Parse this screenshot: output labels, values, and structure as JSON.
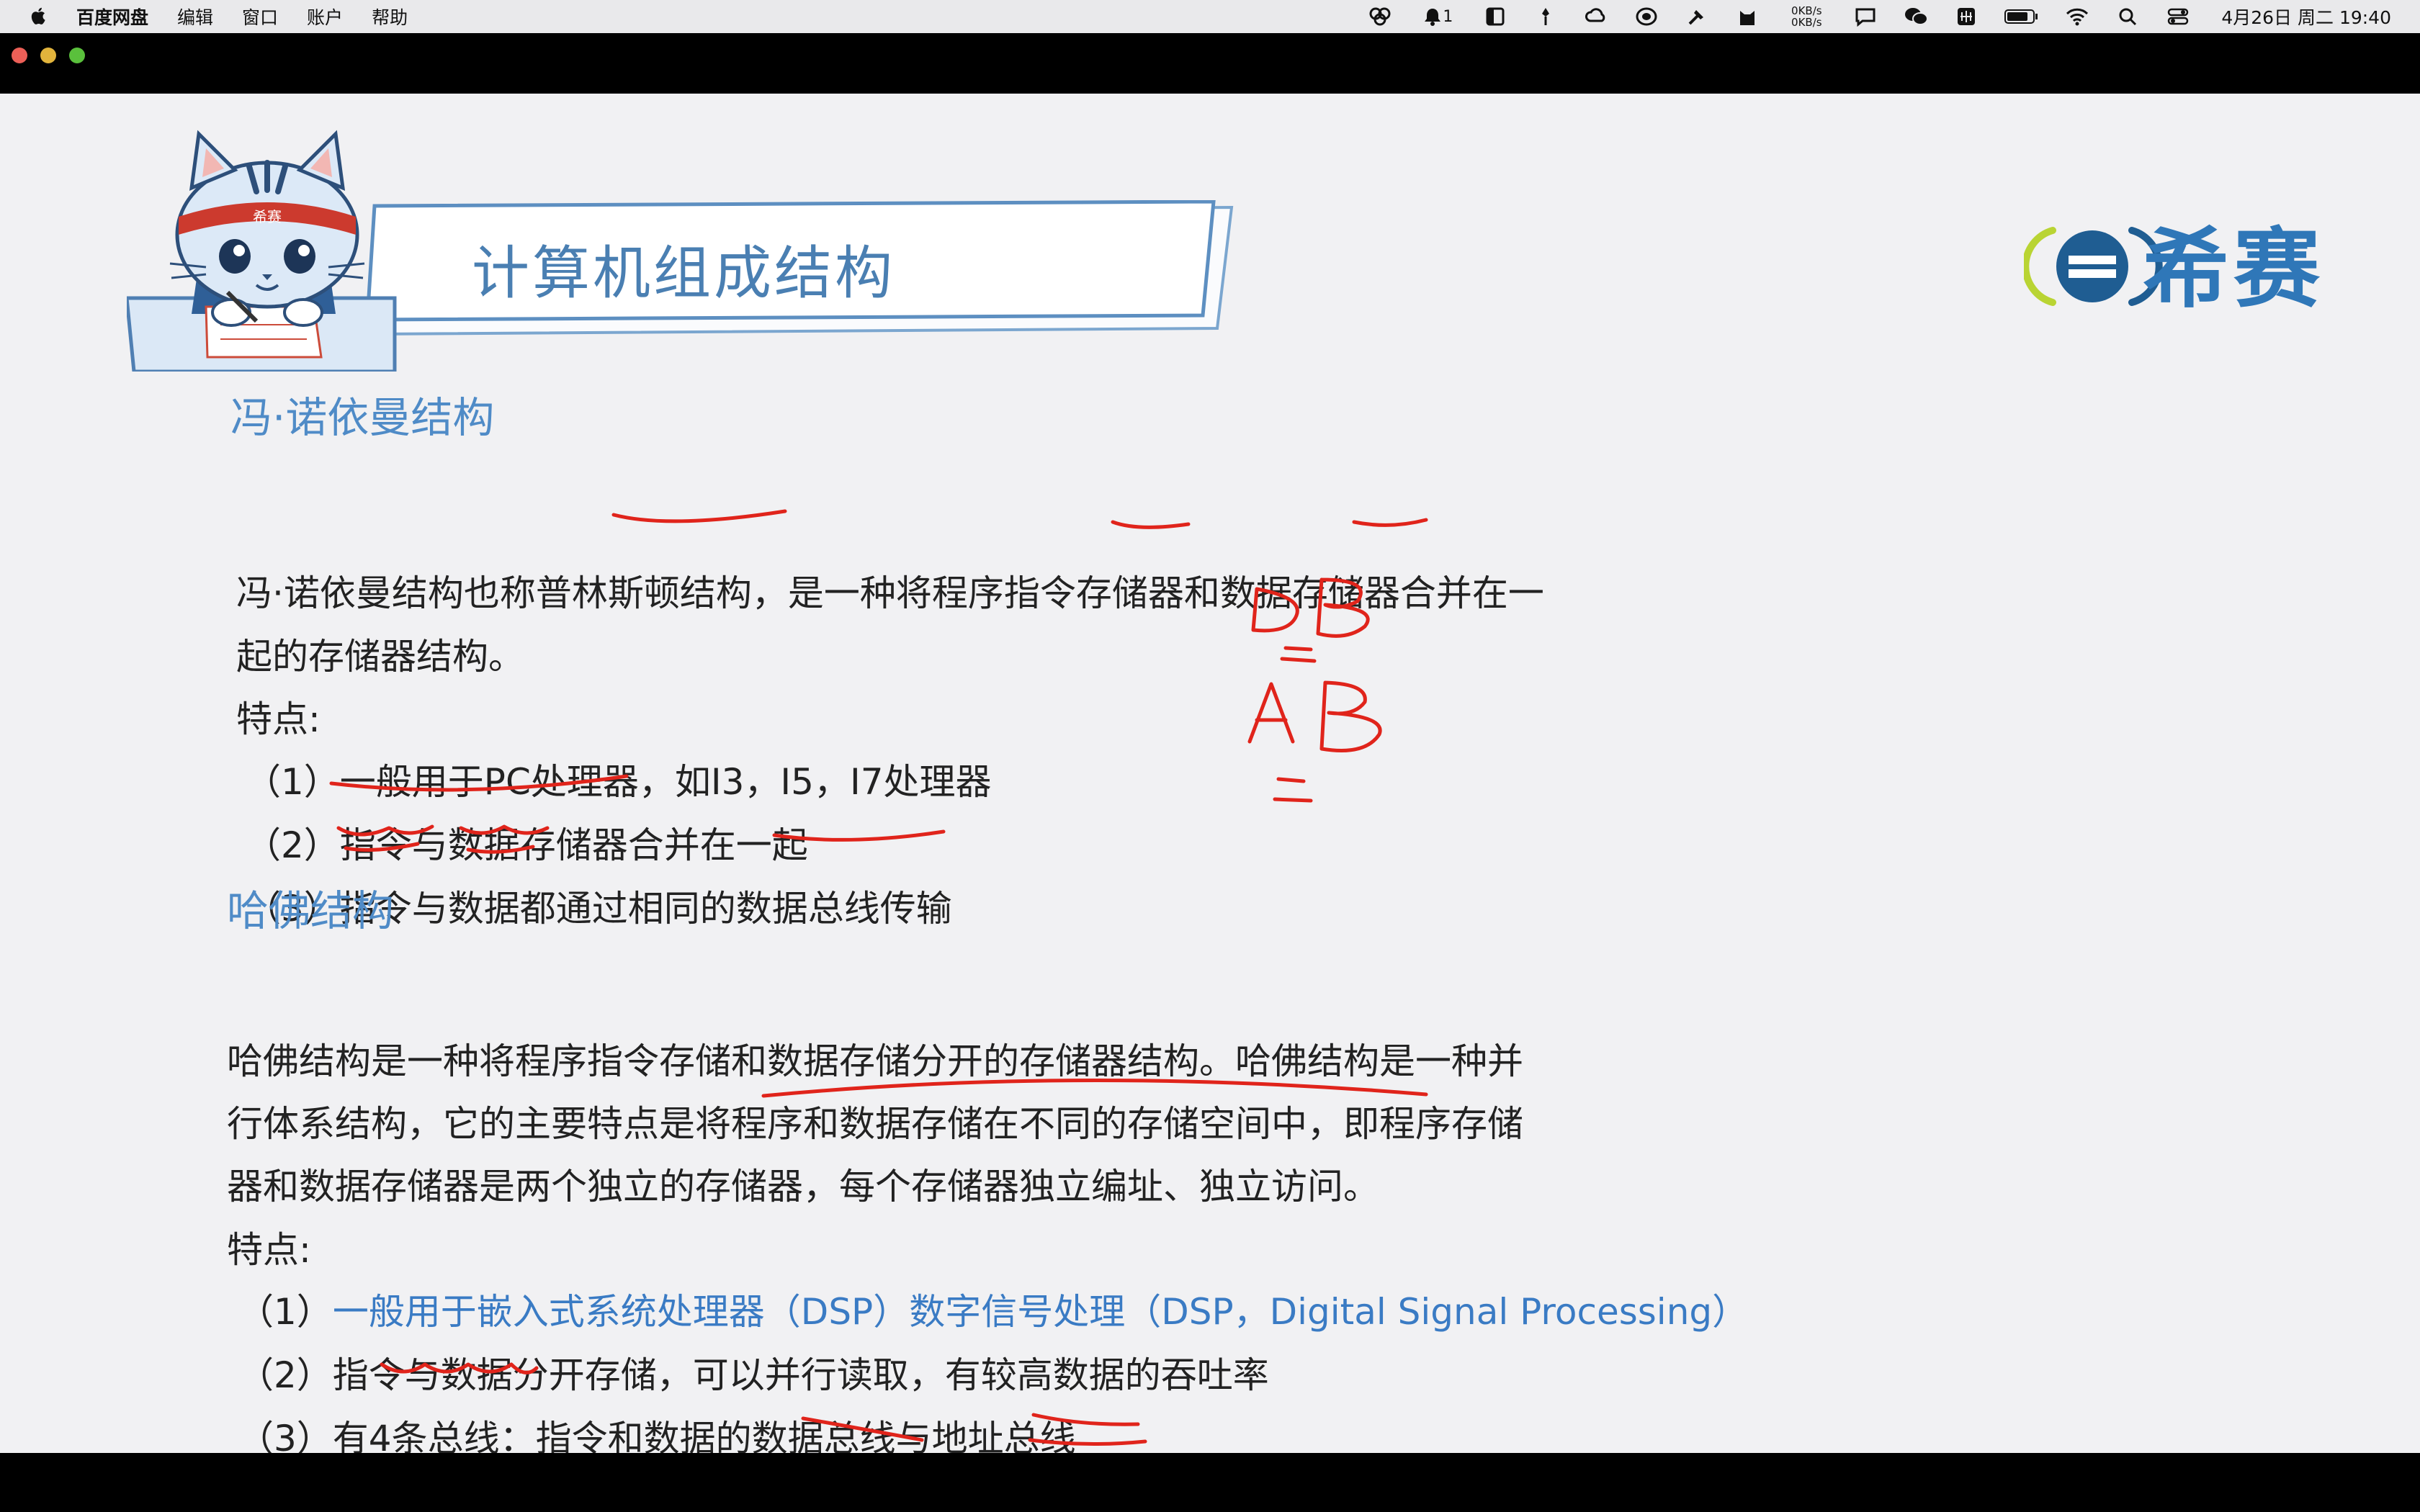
{
  "menubar": {
    "app_name": "百度网盘",
    "menus": [
      "编辑",
      "窗口",
      "账户",
      "帮助"
    ],
    "notification_count": "1",
    "net_up": "0KB/s",
    "net_down": "0KB/s",
    "clock": "4月26日 周二 19:40"
  },
  "slide": {
    "title": "计算机组成结构",
    "logo_text": "希赛",
    "mascot_band_text": "希赛",
    "von_neumann": {
      "heading": "冯·诺依曼结构",
      "desc_line1": "冯·诺依曼结构也称普林斯顿结构，是一种将程序指令存储器和数据存储器合并在一",
      "desc_line2": "起的存储器结构。",
      "features_label": "特点:",
      "features": [
        "（1）一般用于PC处理器，如I3，I5，I7处理器",
        "（2）指令与数据存储器合并在一起",
        "（3）指令与数据都通过相同的数据总线传输"
      ]
    },
    "harvard": {
      "heading": "哈佛结构",
      "desc_line1": "哈佛结构是一种将程序指令存储和数据存储分开的存储器结构。哈佛结构是一种并",
      "desc_line2": "行体系结构，它的主要特点是将程序和数据存储在不同的存储空间中，即程序存储",
      "desc_line3": "器和数据存储器是两个独立的存储器，每个存储器独立编址、独立访问。",
      "features_label": "特点:",
      "feature1_prefix": "（1）",
      "feature1_text": "一般用于嵌入式系统处理器（DSP）数字信号处理（DSP，Digital Signal Processing）",
      "features": [
        "（2）指令与数据分开存储，可以并行读取，有较高数据的吞吐率",
        "（3）有4条总线：指令和数据的数据总线与地址总线"
      ]
    },
    "handwriting": {
      "line1": "DB",
      "line2": "AB"
    }
  },
  "colors": {
    "heading_blue": "#4f8bc7",
    "ink_red": "#e0241b",
    "slide_bg": "#f1f1f3"
  }
}
